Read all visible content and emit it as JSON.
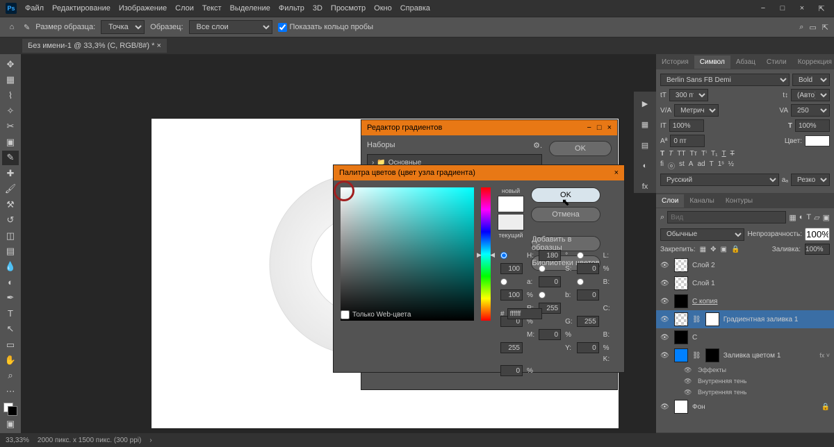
{
  "app_logo": "Ps",
  "menu": [
    "Файл",
    "Редактирование",
    "Изображение",
    "Слои",
    "Текст",
    "Выделение",
    "Фильтр",
    "3D",
    "Просмотр",
    "Окно",
    "Справка"
  ],
  "win_controls": [
    "−",
    "□",
    "×",
    "⇱"
  ],
  "options": {
    "sample_size_label": "Размер образца:",
    "sample_size_value": "Точка",
    "sample_label": "Образец:",
    "sample_value": "Все слои",
    "show_ring": "Показать кольцо пробы"
  },
  "tab_title": "Без имени-1 @ 33,3% (C, RGB/8#) *",
  "status_zoom": "33,33%",
  "status_dims": "2000 пикс. x 1500 пикс. (300 ppi)",
  "char_panel": {
    "tabs": [
      "История",
      "Символ",
      "Абзац",
      "Стили",
      "Коррекция"
    ],
    "font": "Berlin Sans FB Demi",
    "weight": "Bold",
    "size": "300 пт",
    "leading": "(Авто)",
    "kerning": "Метрически",
    "tracking": "250",
    "vscale": "100%",
    "baseline": "0 пт",
    "color_label": "Цвет:",
    "lang": "Русский",
    "aa": "Резкое"
  },
  "layers_panel": {
    "tabs": [
      "Слои",
      "Каналы",
      "Контуры"
    ],
    "search_placeholder": "Вид",
    "blend_mode": "Обычные",
    "opacity_label": "Непрозрачность:",
    "opacity": "100%",
    "lock_label": "Закрепить:",
    "fill_label": "Заливка:",
    "fill": "100%",
    "layers": [
      {
        "name": "Слой 2",
        "thumb": "checker"
      },
      {
        "name": "Слой 1",
        "thumb": "checker"
      },
      {
        "name": "С копия",
        "thumb": "blk",
        "link": true
      },
      {
        "name": "Градиентная заливка 1",
        "thumb": "checker",
        "selected": true,
        "mask": true
      },
      {
        "name": "C",
        "thumb": "blk",
        "link": true
      },
      {
        "name": "Заливка цветом 1",
        "thumb": "blue",
        "mask": true,
        "fx": true
      },
      {
        "name": "Фон",
        "thumb": "wht",
        "lock": true
      }
    ],
    "fx_label": "Эффекты",
    "fx_items": [
      "Внутренняя тень",
      "Внутренняя тень"
    ]
  },
  "gradient_editor": {
    "title": "Редактор градиентов",
    "presets_label": "Наборы",
    "folder": "Основные",
    "ok": "OK"
  },
  "color_picker": {
    "title": "Палитра цветов (цвет узла градиента)",
    "ok": "OK",
    "cancel": "Отмена",
    "add_swatch": "Добавить в образцы",
    "libraries": "Библиотеки цветов",
    "new_label": "новый",
    "current_label": "текущий",
    "web_only": "Только Web-цвета",
    "H": "180",
    "S": "0",
    "B": "100",
    "L": "100",
    "a": "0",
    "b": "0",
    "R": "255",
    "G": "255",
    "Bb": "255",
    "C": "0",
    "M": "0",
    "Y": "0",
    "K": "0",
    "hex": "ffffff"
  }
}
